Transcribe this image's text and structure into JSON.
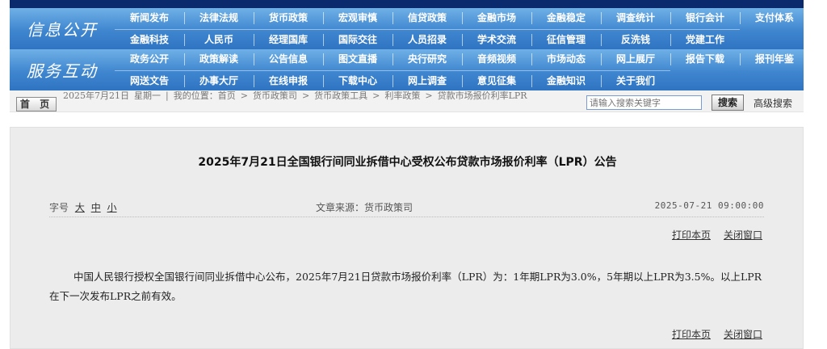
{
  "nav": {
    "info_title": "信息公开",
    "service_title": "服务互动",
    "row1": [
      "新闻发布",
      "法律法规",
      "货币政策",
      "宏观审慎",
      "信贷政策",
      "金融市场",
      "金融稳定",
      "调查统计",
      "银行会计",
      "支付体系"
    ],
    "row2": [
      "金融科技",
      "人民币",
      "经理国库",
      "国际交往",
      "人员招录",
      "学术交流",
      "征信管理",
      "反洗钱",
      "党建工作"
    ],
    "row3": [
      "政务公开",
      "政策解读",
      "公告信息",
      "图文直播",
      "央行研究",
      "音频视频",
      "市场动态",
      "网上展厅",
      "报告下载",
      "报刊年鉴"
    ],
    "row4": [
      "网送文告",
      "办事大厅",
      "在线申报",
      "下载中心",
      "网上调查",
      "意见征集",
      "金融知识",
      "关于我们"
    ]
  },
  "crumb": {
    "home": "首 页",
    "date": "2025年7月21日",
    "weekday": "星期一",
    "sep": "|",
    "location": "我的位置：首页",
    "items": [
      "货币政策司",
      "货币政策工具",
      "利率政策",
      "贷款市场报价利率LPR"
    ],
    "arrow": ">"
  },
  "search": {
    "placeholder": "请输入搜索关键字",
    "button": "搜索",
    "advanced": "高级搜索"
  },
  "article": {
    "title": "2025年7月21日全国银行间同业拆借中心受权公布贷款市场报价利率（LPR）公告",
    "fontsize_label": "字号",
    "fontsize_large": "大",
    "fontsize_medium": "中",
    "fontsize_small": "小",
    "source": "文章来源：货币政策司",
    "date": "2025-07-21 09:00:00",
    "print": "打印本页",
    "close": "关闭窗口",
    "body": "中国人民银行授权全国银行间同业拆借中心公布，2025年7月21日贷款市场报价利率（LPR）为：1年期LPR为3.0%，5年期以上LPR为3.5%。以上LPR在下一次发布LPR之前有效。"
  }
}
